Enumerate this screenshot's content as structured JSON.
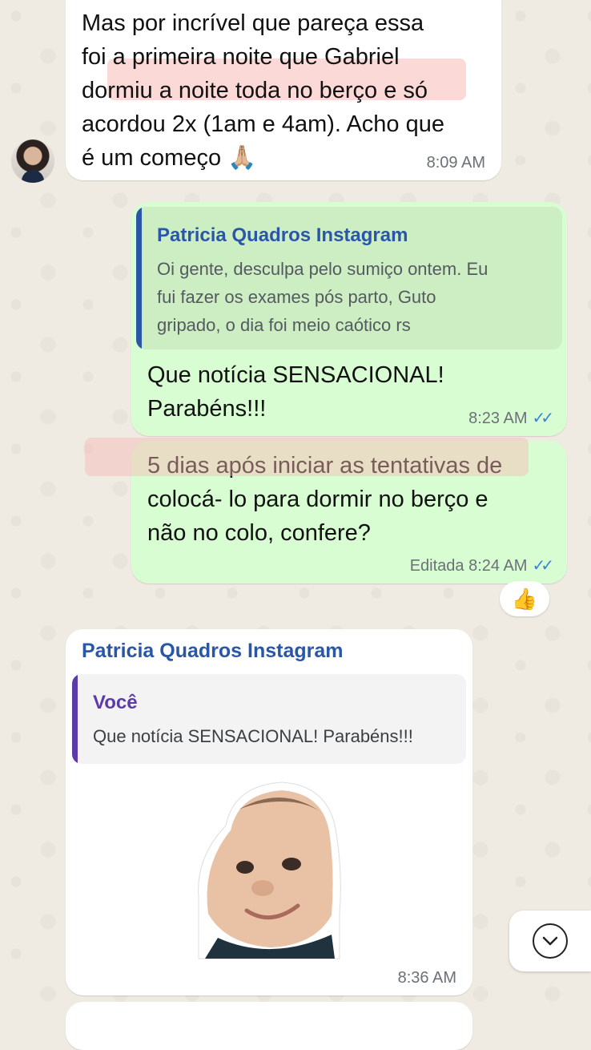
{
  "messages": {
    "m1": {
      "lines": [
        "Mas por incrível que pareça essa",
        "foi a primeira noite que Gabriel",
        "dormiu a noite toda no berço e só",
        "acordou 2x (1am e 4am). Acho que",
        "é um começo 🙏🏼"
      ],
      "time": "8:09 AM"
    },
    "m2": {
      "quote_author": "Patricia Quadros Instagram",
      "quote_lines": [
        "Oi gente, desculpa pelo sumiço ontem. Eu",
        "fui fazer os exames pós parto, Guto",
        "gripado, o dia foi meio caótico rs"
      ],
      "lines": [
        "Que notícia SENSACIONAL!",
        "Parabéns!!!"
      ],
      "time": "8:23 AM",
      "ticks": "✓✓"
    },
    "m3": {
      "lines": [
        "5 dias após iniciar as tentativas de",
        "colocá- lo para dormir no berço e",
        "não no colo, confere?"
      ],
      "time": "Editada 8:24 AM",
      "ticks": "✓✓",
      "reaction": "👍"
    },
    "m4": {
      "sender": "Patricia Quadros Instagram",
      "quote_author": "Você",
      "quote_text": "Que notícia SENSACIONAL! Parabéns!!!",
      "time": "8:36 AM"
    }
  },
  "colors": {
    "background": "#efeae2",
    "incoming_bubble": "#ffffff",
    "outgoing_bubble": "#d9fdd3",
    "sender_name": "#2a56a8",
    "quote_bar_blue": "#2a56a8",
    "quote_bar_purple": "#5b3ba8",
    "read_ticks": "#3b82d6",
    "highlight": "#f8b9b4"
  },
  "icons": {
    "scroll_down": "chevron-down-circle-icon",
    "reaction": "thumbs-up-emoji",
    "prayer": "folded-hands-emoji"
  }
}
